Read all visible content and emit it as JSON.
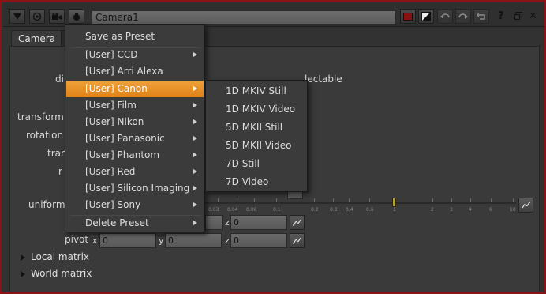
{
  "window": {
    "node_name": "Camera1",
    "border_color": "#8a1414",
    "accent_color": "#e8911f"
  },
  "tabs": [
    {
      "label": "Camera"
    }
  ],
  "params": {
    "display_label": "di",
    "selectable_partial": "lectable",
    "transform_label": "transform",
    "rotation_label": "rotation",
    "translate_label": "tran",
    "rotate_label": "r",
    "uniform_label": "uniform",
    "pivot_label": "pivot",
    "z_label": "z",
    "x_label": "x",
    "y_label": "y",
    "scale_z_value": "0",
    "pivot_x": "0",
    "pivot_y": "0",
    "pivot_z": "0",
    "slider_ticks": [
      "0.03",
      "0.04",
      "0.06",
      "0.1",
      "0.2",
      "0.3",
      "0.4",
      "0.6",
      "1",
      "2",
      "3",
      "4",
      "6",
      "10"
    ]
  },
  "sections": {
    "local_matrix": "Local matrix",
    "world_matrix": "World matrix"
  },
  "menu": {
    "save_preset": "Save as Preset",
    "items": [
      {
        "label": "[User] CCD"
      },
      {
        "label": "[User] Arri Alexa"
      },
      {
        "label": "[User] Canon"
      },
      {
        "label": "[User] Film"
      },
      {
        "label": "[User] Nikon"
      },
      {
        "label": "[User] Panasonic"
      },
      {
        "label": "[User] Phantom"
      },
      {
        "label": "[User] Red"
      },
      {
        "label": "[User] Silicon Imaging"
      },
      {
        "label": "[User] Sony"
      }
    ],
    "highlighted": "[User] Canon",
    "delete_preset": "Delete Preset"
  },
  "submenu": {
    "items": [
      {
        "label": "1D MKIV Still"
      },
      {
        "label": "1D MKIV Video"
      },
      {
        "label": "5D MKII Still"
      },
      {
        "label": "5D MKII Video"
      },
      {
        "label": "7D Still"
      },
      {
        "label": "7D Video"
      }
    ]
  },
  "titlebar": {
    "help": "?"
  }
}
